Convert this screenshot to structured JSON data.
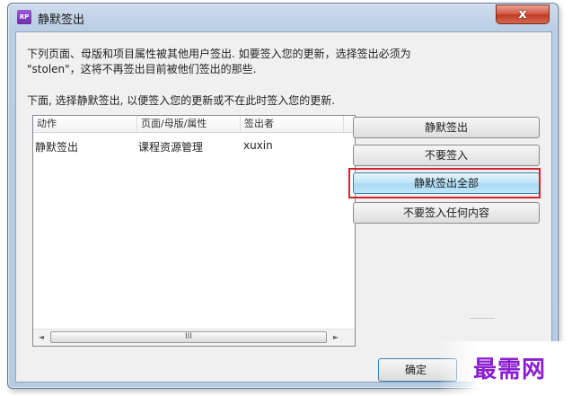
{
  "window": {
    "icon_label": "RP",
    "title": "静默签出",
    "close_glyph": "x"
  },
  "message": {
    "line1": "下列页面、母版和项目属性被其他用户签出. 如要签入您的更新，选择签出必须为",
    "line2": "\"stolen\"，这将不再签出目前被他们签出的那些.",
    "line3": "下面, 选择静默签出, 以便签入您的更新或不在此时签入您的更新."
  },
  "list": {
    "columns": [
      "动作",
      "页面/母版/属性",
      "签出者"
    ],
    "rows": [
      {
        "action": "静默签出",
        "item": "课程资源管理",
        "owner": "xuxin"
      }
    ],
    "scroll_left": "◄",
    "scroll_right": "►",
    "scroll_grip": "III"
  },
  "buttons": {
    "silent_checkout": "静默签出",
    "no_checkin": "不要签入",
    "silent_checkout_all": "静默签出全部",
    "no_checkin_anything": "不要签入任何内容",
    "ok": "确定"
  },
  "watermark": "最需网",
  "colors": {
    "highlight_border": "#d3242c",
    "watermark": "#8b1fcf",
    "hot_button": "#bde3f7"
  }
}
